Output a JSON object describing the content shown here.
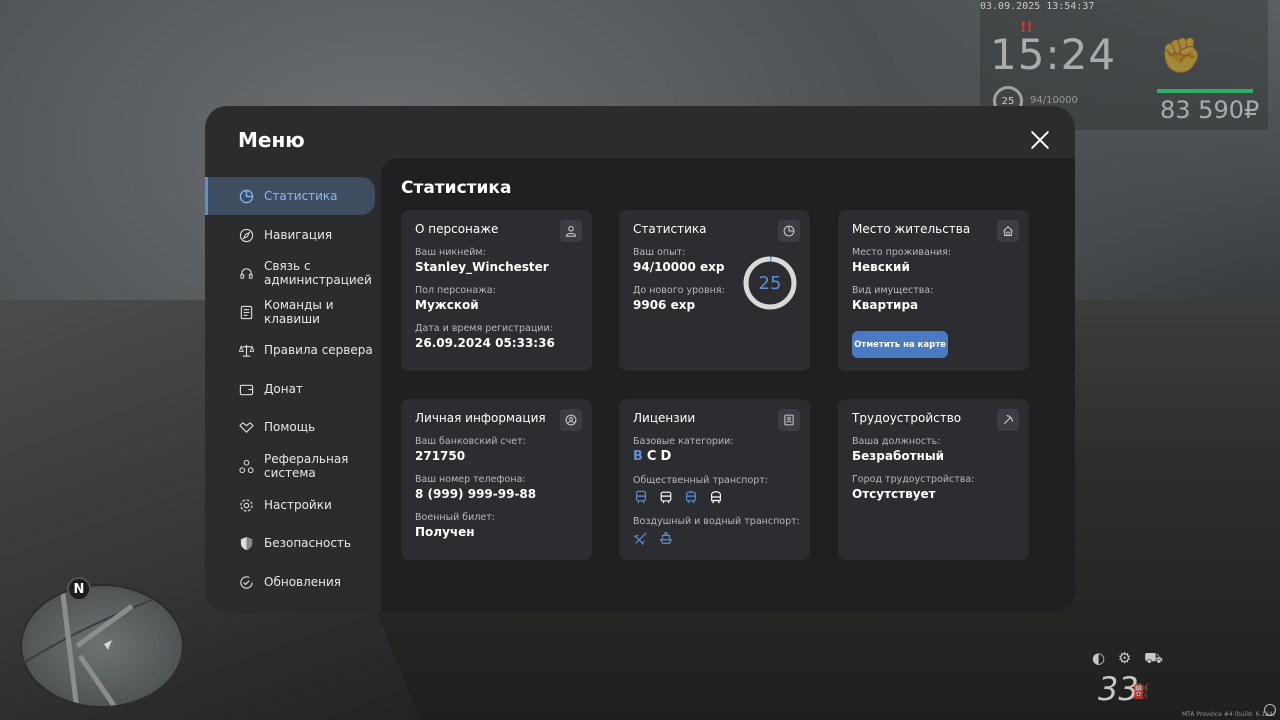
{
  "hud": {
    "date": "03.09.2025 13:54:37",
    "alert": "!!",
    "time": "15:24",
    "level": "25",
    "exp": "94/10000",
    "money": "83 590₽",
    "speed": "33"
  },
  "watermark": "MTA Province #4 (build: 6.124)",
  "menu": {
    "title": "Меню",
    "sidebar": [
      {
        "label": "Статистика",
        "icon": "pie-chart-icon"
      },
      {
        "label": "Навигация",
        "icon": "compass-icon"
      },
      {
        "label": "Связь с\nадминистрацией",
        "icon": "headset-icon"
      },
      {
        "label": "Команды и\nклавиши",
        "icon": "list-icon"
      },
      {
        "label": "Правила сервера",
        "icon": "scales-icon"
      },
      {
        "label": "Донат",
        "icon": "wallet-icon"
      },
      {
        "label": "Помощь",
        "icon": "handshake-icon"
      },
      {
        "label": "Реферальная\nсистема",
        "icon": "network-icon"
      },
      {
        "label": "Настройки",
        "icon": "gear-icon"
      },
      {
        "label": "Безопасность",
        "icon": "shield-icon"
      },
      {
        "label": "Обновления",
        "icon": "refresh-check-icon"
      }
    ],
    "content_title": "Статистика",
    "cards": {
      "character": {
        "title": "О персонаже",
        "nick_label": "Ваш никнейм:",
        "nick": "Stanley_Winchester",
        "sex_label": "Пол персонажа:",
        "sex": "Мужской",
        "reg_label": "Дата и время регистрации:",
        "reg": "26.09.2024 05:33:36"
      },
      "stats": {
        "title": "Статистика",
        "exp_label": "Ваш опыт:",
        "exp": "94/10000 exp",
        "next_label": "До нового уровня:",
        "next": "9906 exp",
        "level": "25"
      },
      "residence": {
        "title": "Место жительства",
        "place_label": "Место проживания:",
        "place": "Невский",
        "type_label": "Вид имущества:",
        "type": "Квартира",
        "button": "Отметить на карте"
      },
      "personal": {
        "title": "Личная информация",
        "bank_label": "Ваш банковский счет:",
        "bank": "271750",
        "phone_label": "Ваш номер телефона:",
        "phone": "8 (999) 999-99-88",
        "military_label": "Военный билет:",
        "military": "Получен"
      },
      "licenses": {
        "title": "Лицензии",
        "base_label": "Базовые категории:",
        "cat_b": "B",
        "cat_c": "C",
        "cat_d": "D",
        "public_label": "Общественный транспорт:",
        "air_label": "Воздушный и водный транспорт:"
      },
      "job": {
        "title": "Трудоустройство",
        "position_label": "Ваша должность:",
        "position": "Безработный",
        "city_label": "Город трудоустройства:",
        "city": "Отсутствует"
      }
    }
  },
  "colors": {
    "accent": "#5f8fd1",
    "panel": "#2b2c2e",
    "card": "#2c2d30",
    "button": "#4a7ac2"
  },
  "level_progress": 0.94
}
